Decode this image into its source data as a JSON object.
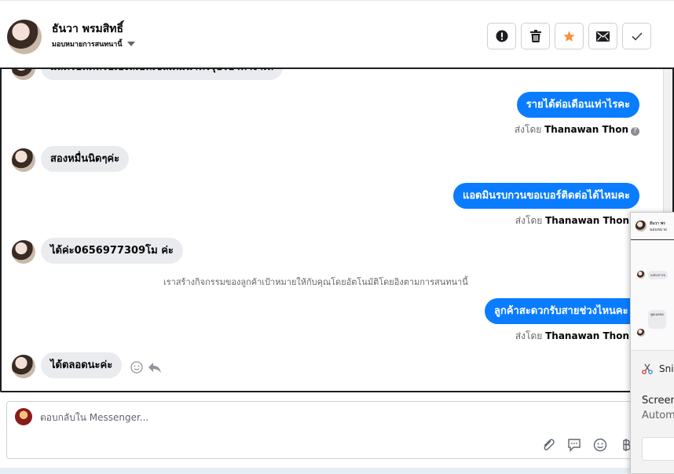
{
  "header": {
    "name": "ธันวา พรมสิทธิ์",
    "assign_label": "มอบหมายการสนทนานี้",
    "actions": [
      "mark-spam",
      "delete",
      "star",
      "mark-unread",
      "done"
    ]
  },
  "messages": {
    "cut_text": "มีสตรบทิตหรบเบงลเบทเข่ลเดมนาทรรุบ่รบำทางาเห",
    "out1": "รายได้ต่อเดือนเท่าไรคะ",
    "sent_prefix": "ส่งโดย",
    "sender": "Thanawan Thon",
    "in1": "สองหมื่นนิดๆค่ะ",
    "out2": "แอดมินรบกวนขอเบอร์ติดต่อได้ไหมคะ",
    "in2": "ได้ค่ะ0656977309โม ค่ะ",
    "system": "เราสร้างกิจกรรมของลูกค้าเป้าหมายให้กับคุณโดยอัตโนมัติโดยอิงตามการสนทนานี้",
    "out3": "ลูกค้าสะดวกรับสายช่วงไหนคะ",
    "in3": "ได้ตลอดนะค่ะ"
  },
  "composer": {
    "placeholder": "ตอบกลับใน Messenger..."
  },
  "overlay": {
    "thumb_name": "ธันวา พร",
    "thumb_sub": "มอบหมาย",
    "thumb_msg1": "แสดงการข",
    "thumb_msg2": "พูดเมตตอ",
    "snip_app": "Sni",
    "snip_line1": "Screen",
    "snip_line2": "Autom"
  },
  "colors": {
    "accent": "#0a7cff",
    "star": "#f7923b"
  }
}
